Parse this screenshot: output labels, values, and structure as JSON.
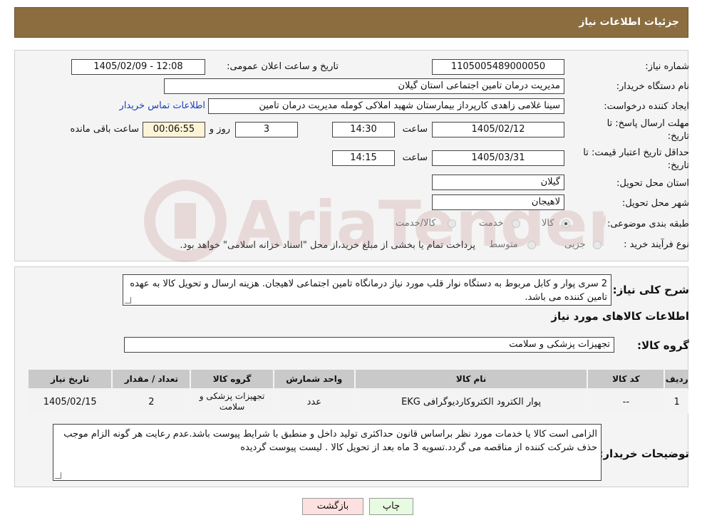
{
  "header": {
    "title": "جزئیات اطلاعات نیاز"
  },
  "form": {
    "need_number_label": "شماره نیاز:",
    "need_number": "1105005489000050",
    "announce_label": "تاریخ و ساعت اعلان عمومی:",
    "announce_value": "1405/02/09 - 12:08",
    "buyer_org_label": "نام دستگاه خریدار:",
    "buyer_org": "مدیریت درمان تامین اجتماعی استان گیلان",
    "requester_label": "ایجاد کننده درخواست:",
    "requester": "سینا غلامی زاهدی کارپرداز بیمارستان شهید املاکی کومله مدیریت درمان تامین",
    "contact_link": "اطلاعات تماس خریدار",
    "deadline_label": "مهلت ارسال پاسخ: تا",
    "deadline_label2": "تاریخ:",
    "deadline_date": "1405/02/12",
    "time_label": "ساعت",
    "deadline_time": "14:30",
    "days_value": "3",
    "days_label": "روز و",
    "remaining_value": "00:06:55",
    "remaining_label": "ساعت باقی مانده",
    "validity_label": "حداقل تاریخ اعتبار قیمت: تا",
    "validity_label2": "تاریخ:",
    "validity_date": "1405/03/31",
    "validity_time_label": "ساعت",
    "validity_time": "14:15",
    "province_label": "استان محل تحویل:",
    "province": "گیلان",
    "city_label": "شهر محل تحویل:",
    "city": "لاهیجان",
    "category_label": "طبقه بندی موضوعی:",
    "category_options": [
      "کالا",
      "خدمت",
      "کالا/خدمت"
    ],
    "category_selected": "کالا",
    "purchase_label": "نوع فرآیند خرید :",
    "purchase_options": [
      "جزیی",
      "متوسط"
    ],
    "purchase_note": "پرداخت تمام یا بخشی از مبلغ خرید،از محل \"اسناد خزانه اسلامی\" خواهد بود."
  },
  "description": {
    "label": "شرح کلی نیاز:",
    "text": "2 سری پوار و کابل  مربوط به دستگاه نوار قلب مورد نیاز درمانگاه تامین اجتماعی لاهیجان. هزینه ارسال و تحویل کالا به عهده تامین کننده می باشد."
  },
  "goods": {
    "section_title": "اطلاعات کالاهای مورد نیاز",
    "group_label": "گروه کالا:",
    "group_value": "تجهیزات پزشکی و سلامت",
    "columns": [
      "ردیف",
      "کد کالا",
      "نام کالا",
      "واحد شمارش",
      "گروه کالا",
      "تعداد / مقدار",
      "تاریخ نیاز"
    ],
    "rows": [
      [
        "1",
        "--",
        "پوار الکترود الکتروکاردیوگرافی EKG",
        "عدد",
        "تجهیزات پزشکی و سلامت",
        "2",
        "1405/02/15"
      ]
    ]
  },
  "buyer_notes": {
    "label": "توضیحات خریدار:",
    "text": "الزامی است کالا یا خدمات مورد نظر براساس قانون حداکثری تولید داخل و منطبق با شرایط پیوست باشد.عدم رعایت هر گونه الزام موجب حذف شرکت کننده از مناقصه می گردد.تسویه 3 ماه بعد از تحویل کالا . لیست پیوست گردیده"
  },
  "actions": {
    "print": "چاپ",
    "back": "بازگشت"
  },
  "colors": {
    "header_bg": "#8c6d3f",
    "link": "#1a3fbf"
  }
}
